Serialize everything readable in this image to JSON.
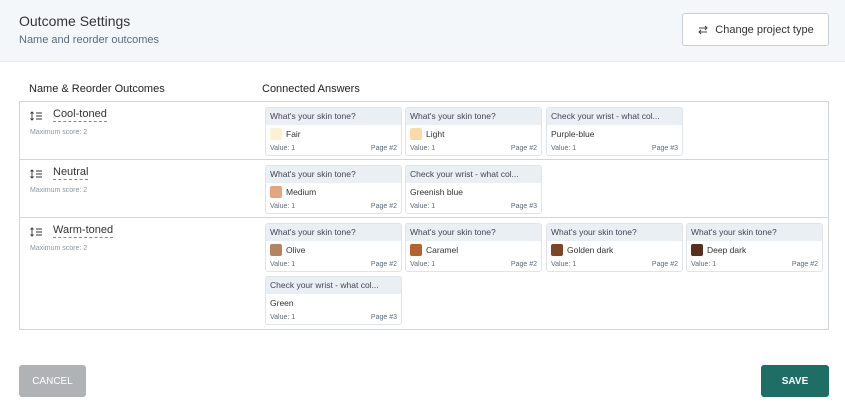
{
  "header": {
    "title": "Outcome Settings",
    "subtitle": "Name and reorder outcomes",
    "change_button": "Change project type"
  },
  "columns": {
    "outcomes": "Name & Reorder Outcomes",
    "answers": "Connected Answers"
  },
  "outcomes": [
    {
      "name": "Cool-toned",
      "max_score": "Maximum score: 2",
      "answers": [
        {
          "question": "What's your skin tone?",
          "answer": "Fair",
          "swatch": "#fdf0d5",
          "value": "Value: 1",
          "page": "Page #2"
        },
        {
          "question": "What's your skin tone?",
          "answer": "Light",
          "swatch": "#fadba8",
          "value": "Value: 1",
          "page": "Page #2"
        },
        {
          "question": "Check your wrist - what col...",
          "answer": "Purple-blue",
          "swatch": "",
          "value": "Value: 1",
          "page": "Page #3"
        }
      ]
    },
    {
      "name": "Neutral",
      "max_score": "Maximum score: 2",
      "answers": [
        {
          "question": "What's your skin tone?",
          "answer": "Medium",
          "swatch": "#e6a47f",
          "value": "Value: 1",
          "page": "Page #2"
        },
        {
          "question": "Check your wrist - what col...",
          "answer": "Greenish blue",
          "swatch": "",
          "value": "Value: 1",
          "page": "Page #3"
        }
      ]
    },
    {
      "name": "Warm-toned",
      "max_score": "Maximum score: 2",
      "answers": [
        {
          "question": "What's your skin tone?",
          "answer": "Olive",
          "swatch": "#b3845e",
          "value": "Value: 1",
          "page": "Page #2"
        },
        {
          "question": "What's your skin tone?",
          "answer": "Caramel",
          "swatch": "#b4632d",
          "value": "Value: 1",
          "page": "Page #2"
        },
        {
          "question": "What's your skin tone?",
          "answer": "Golden dark",
          "swatch": "#7d4527",
          "value": "Value: 1",
          "page": "Page #2"
        },
        {
          "question": "What's your skin tone?",
          "answer": "Deep dark",
          "swatch": "#5a2e1c",
          "value": "Value: 1",
          "page": "Page #2"
        },
        {
          "question": "Check your wrist - what col...",
          "answer": "Green",
          "swatch": "",
          "value": "Value: 1",
          "page": "Page #3"
        }
      ]
    }
  ],
  "footer": {
    "cancel": "CANCEL",
    "save": "SAVE"
  },
  "colors": {
    "save_bg": "#1f6e66",
    "cancel_bg": "#b0b3b6",
    "header_bg": "#f4f7fa"
  },
  "icons": {
    "change": "swap-arrows-icon",
    "drag": "reorder-handle-icon"
  }
}
